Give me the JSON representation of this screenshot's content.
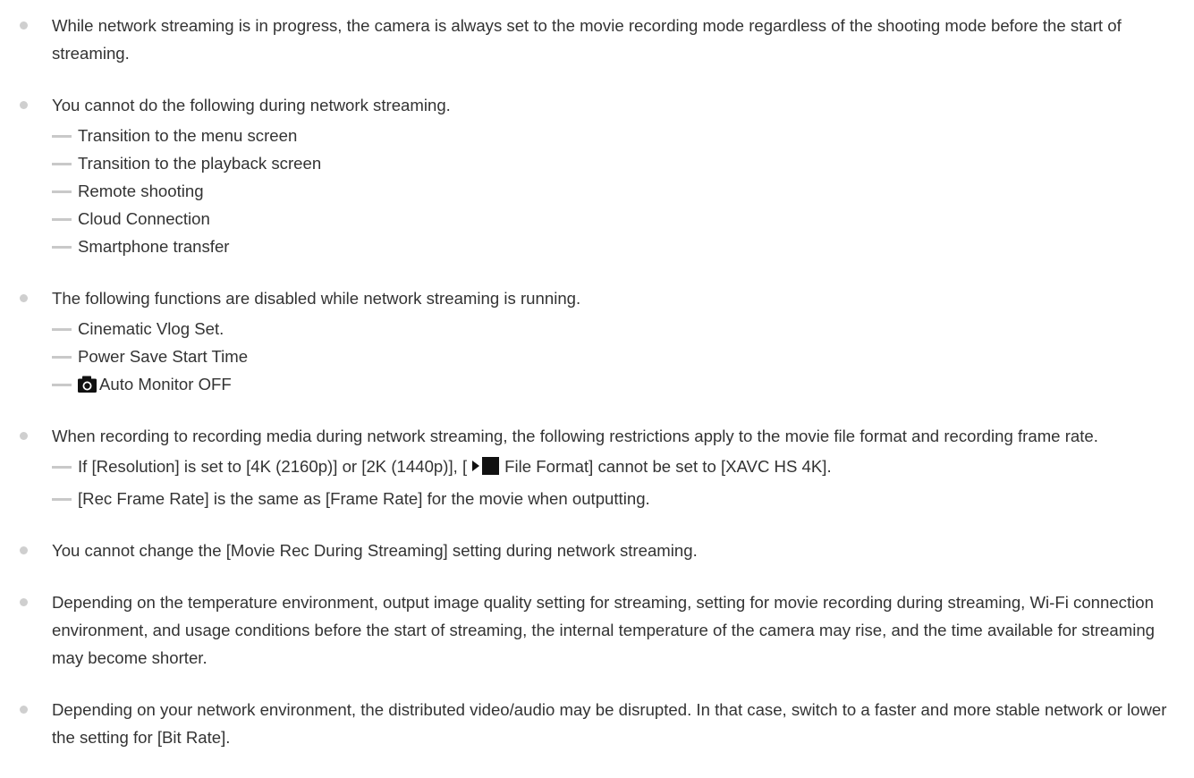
{
  "notes": [
    {
      "text": "While network streaming is in progress, the camera is always set to the movie recording mode regardless of the shooting mode before the start of streaming.",
      "items": []
    },
    {
      "text": "You cannot do the following during network streaming.",
      "items": [
        "Transition to the menu screen",
        "Transition to the playback screen",
        "Remote shooting",
        "Cloud Connection",
        "Smartphone transfer"
      ]
    },
    {
      "text": "The following functions are disabled while network streaming is running.",
      "items": [
        "Cinematic Vlog Set.",
        "Power Save Start Time",
        "Auto Monitor OFF"
      ]
    },
    {
      "text": "When recording to recording media during network streaming, the following restrictions apply to the movie file format and recording frame rate.",
      "items": [
        {
          "before": "If [Resolution] is set to [4K (2160p)] or [2K (1440p)], [",
          "after": "File Format] cannot be set to [XAVC HS 4K]."
        },
        "[Rec Frame Rate] is the same as [Frame Rate] for the movie when outputting."
      ]
    },
    {
      "text": "You cannot change the [Movie Rec During Streaming] setting during network streaming.",
      "items": []
    },
    {
      "text": "Depending on the temperature environment, output image quality setting for streaming, setting for movie recording during streaming, Wi-Fi connection environment, and usage conditions before the start of streaming, the internal temperature of the camera may rise, and the time available for streaming may become shorter.",
      "items": []
    },
    {
      "text": "Depending on your network environment, the distributed video/audio may be disrupted. In that case, switch to a faster and more stable network or lower the setting for [Bit Rate].",
      "items": []
    }
  ],
  "icons": {
    "still_camera": "still-camera-icon",
    "movie_mode": "movie-mode-icon"
  }
}
